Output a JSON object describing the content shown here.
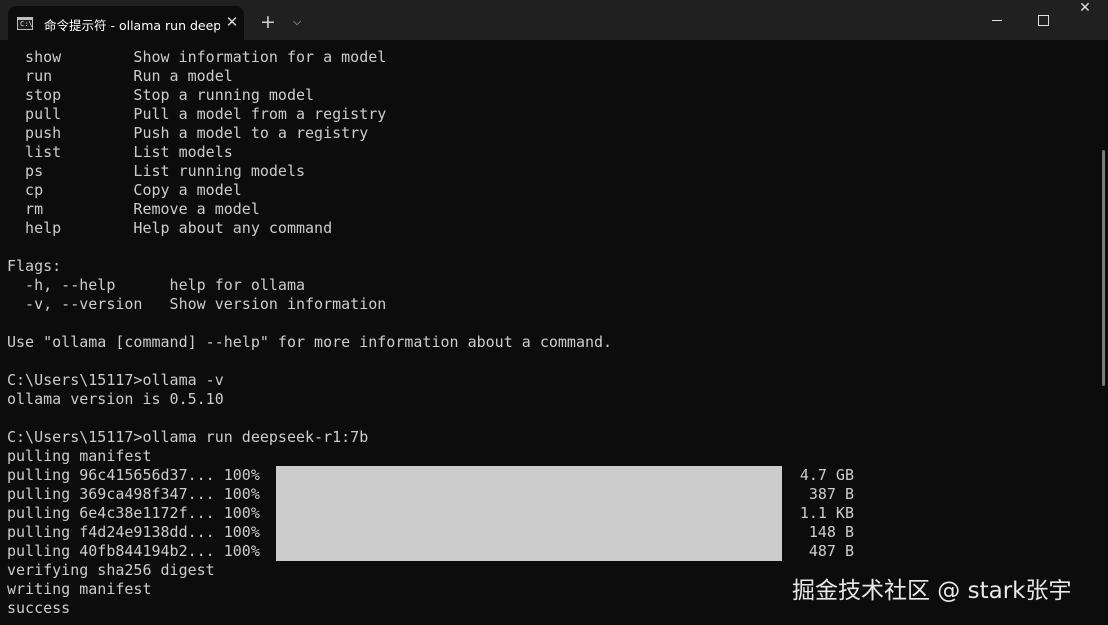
{
  "titlebar": {
    "tab_title": "命令提示符 - ollama  run deep",
    "close_glyph": "✕",
    "new_tab_glyph": "+",
    "dropdown_glyph": "⌵",
    "window_close_glyph": "✕",
    "icons": [
      "cmd-icon",
      "close-icon",
      "plus-icon",
      "chevron-down-icon",
      "minimize-icon",
      "maximize-icon",
      "close-icon"
    ]
  },
  "terminal": {
    "commands": [
      {
        "name": "show",
        "desc": "Show information for a model"
      },
      {
        "name": "run",
        "desc": "Run a model"
      },
      {
        "name": "stop",
        "desc": "Stop a running model"
      },
      {
        "name": "pull",
        "desc": "Pull a model from a registry"
      },
      {
        "name": "push",
        "desc": "Push a model to a registry"
      },
      {
        "name": "list",
        "desc": "List models"
      },
      {
        "name": "ps",
        "desc": "List running models"
      },
      {
        "name": "cp",
        "desc": "Copy a model"
      },
      {
        "name": "rm",
        "desc": "Remove a model"
      },
      {
        "name": "help",
        "desc": "Help about any command"
      }
    ],
    "flags_header": "Flags:",
    "flags": [
      {
        "name": "-h, --help",
        "desc": "help for ollama"
      },
      {
        "name": "-v, --version",
        "desc": "Show version information"
      }
    ],
    "usage_hint": "Use \"ollama [command] --help\" for more information about a command.",
    "prompt_version": "C:\\Users\\15117>ollama -v",
    "version_output": "ollama version is 0.5.10",
    "prompt_run": "C:\\Users\\15117>ollama run deepseek-r1:7b",
    "pulling_manifest": "pulling manifest",
    "layers": [
      {
        "label": "pulling 96c415656d37... 100%",
        "progress": 1.0,
        "size": "4.7 GB"
      },
      {
        "label": "pulling 369ca498f347... 100%",
        "progress": 1.0,
        "size": "387 B"
      },
      {
        "label": "pulling 6e4c38e1172f... 100%",
        "progress": 1.0,
        "size": "1.1 KB"
      },
      {
        "label": "pulling f4d24e9138dd... 100%",
        "progress": 1.0,
        "size": "148 B"
      },
      {
        "label": "pulling 40fb844194b2... 100%",
        "progress": 1.0,
        "size": "487 B"
      }
    ],
    "verifying": "verifying sha256 digest",
    "writing": "writing manifest",
    "success": "success"
  },
  "watermark": "掘金技术社区 @ stark张宇",
  "colors": {
    "terminal_bg": "#0c0c0c",
    "titlebar_bg": "#202020",
    "text": "#cccccc",
    "progress_fill": "#cccccc"
  }
}
